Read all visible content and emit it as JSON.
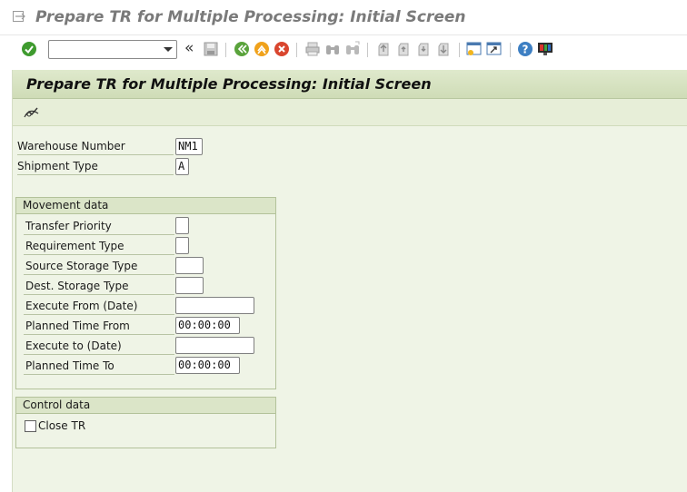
{
  "window": {
    "title": "Prepare TR for Multiple Processing: Initial Screen"
  },
  "toolbar": {
    "command_value": "",
    "icons": [
      "enter-icon",
      "back-icon",
      "exit-icon",
      "cancel-icon",
      "save-icon",
      "print-icon",
      "find-icon",
      "find-next-icon",
      "first-page-icon",
      "previous-page-icon",
      "next-page-icon",
      "last-page-icon",
      "create-session-icon",
      "shortcut-icon",
      "help-icon",
      "customize-layout-icon"
    ]
  },
  "screen": {
    "title": "Prepare TR for Multiple Processing: Initial Screen"
  },
  "header_fields": {
    "warehouse_number": {
      "label": "Warehouse Number",
      "value": "NM1"
    },
    "shipment_type": {
      "label": "Shipment Type",
      "value": "A"
    }
  },
  "movement_data": {
    "title": "Movement data",
    "transfer_priority": {
      "label": "Transfer Priority",
      "value": ""
    },
    "requirement_type": {
      "label": "Requirement Type",
      "value": ""
    },
    "source_storage_type": {
      "label": "Source Storage Type",
      "value": ""
    },
    "dest_storage_type": {
      "label": "Dest. Storage Type",
      "value": ""
    },
    "execute_from_date": {
      "label": "Execute From (Date)",
      "value": ""
    },
    "planned_time_from": {
      "label": "Planned Time From",
      "value": "00:00:00"
    },
    "execute_to_date": {
      "label": "Execute to (Date)",
      "value": ""
    },
    "planned_time_to": {
      "label": "Planned Time To",
      "value": "00:00:00"
    }
  },
  "control_data": {
    "title": "Control data",
    "close_tr": {
      "label": "Close TR",
      "checked": false
    }
  },
  "colors": {
    "content_bg": "#eff4e6",
    "title_bar_bg": "#dfe9cc",
    "group_border": "#b3c29a"
  }
}
